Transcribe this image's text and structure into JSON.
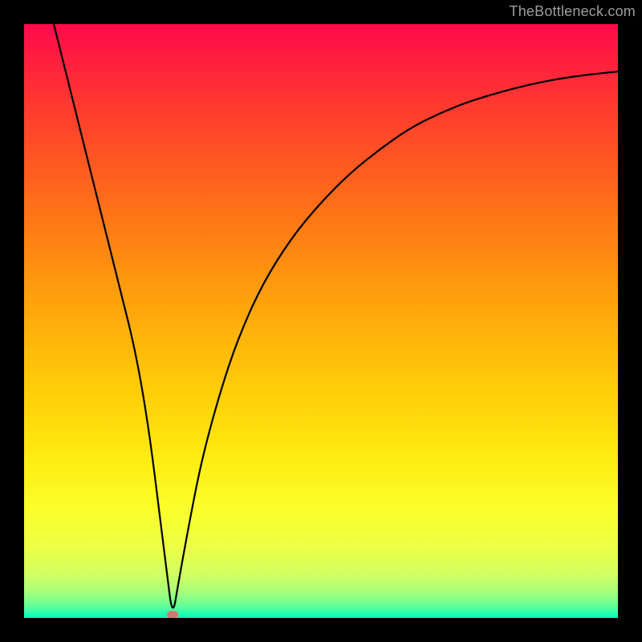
{
  "watermark": "TheBottleneck.com",
  "chart_data": {
    "type": "line",
    "title": "",
    "xlabel": "",
    "ylabel": "",
    "xlim": [
      0,
      100
    ],
    "ylim": [
      0,
      100
    ],
    "grid": false,
    "legend": false,
    "background_gradient": {
      "top": "#ff0a4a",
      "bottom": "#00f7b9",
      "notes": "vertical heat gradient red→orange→yellow→green"
    },
    "series": [
      {
        "name": "bottleneck-curve",
        "x": [
          5,
          10,
          15,
          20,
          24,
          25,
          26,
          28,
          30,
          33,
          36,
          40,
          45,
          50,
          55,
          60,
          65,
          70,
          75,
          80,
          85,
          90,
          95,
          100
        ],
        "values": [
          100,
          80,
          60,
          40,
          8,
          0,
          6,
          17,
          27,
          38,
          47,
          56,
          64,
          70,
          75,
          79,
          82.5,
          85,
          87,
          88.5,
          89.8,
          90.8,
          91.5,
          92
        ]
      }
    ],
    "marker": {
      "x": 25,
      "y": 0,
      "name": "optimum-point",
      "color": "#c97a70"
    }
  },
  "colors": {
    "frame": "#000000",
    "curve": "#000000",
    "marker": "#c97a70",
    "watermark": "#9d9d9d"
  }
}
